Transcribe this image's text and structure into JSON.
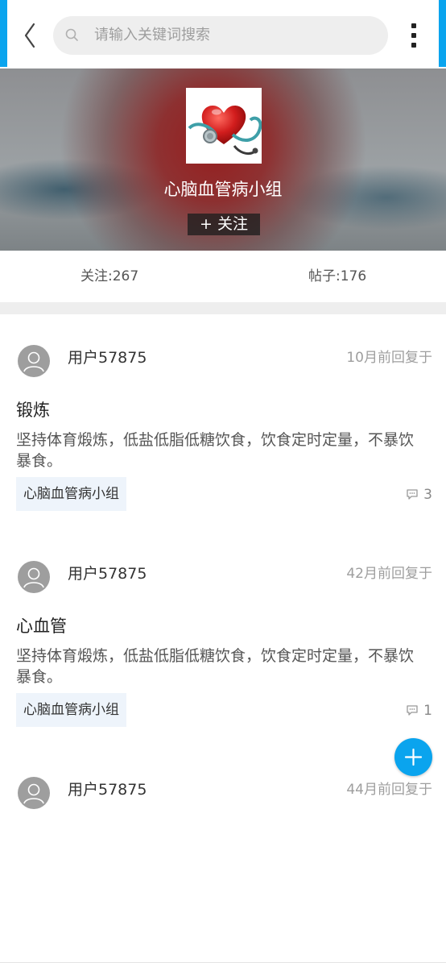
{
  "search": {
    "placeholder": "请输入关键词搜索"
  },
  "group": {
    "name": "心脑血管病小组",
    "follow_label": "+ 关注",
    "followers": "关注:267",
    "posts_count": "帖子:176"
  },
  "posts": [
    {
      "user": "用户57875",
      "time": "10月前回复于",
      "title": "锻炼",
      "body": "坚持体育煅炼，低盐低脂低糖饮食，饮食定时定量，不暴饮暴食。",
      "tag": "心脑血管病小组",
      "comments": "3"
    },
    {
      "user": "用户57875",
      "time": "42月前回复于",
      "title": "心血管",
      "body": "坚持体育煅炼，低盐低脂低糖饮食，饮食定时定量，不暴饮暴食。",
      "tag": "心脑血管病小组",
      "comments": "1"
    },
    {
      "user": "用户57875",
      "time": "44月前回复于"
    }
  ],
  "colors": {
    "accent": "#0aa4ee",
    "tag_bg": "#eef4fb",
    "divider": "#eeeeee"
  },
  "icons": [
    "back-icon",
    "search-icon",
    "more-vertical-icon",
    "user-avatar-icon",
    "comment-icon",
    "plus-icon"
  ]
}
